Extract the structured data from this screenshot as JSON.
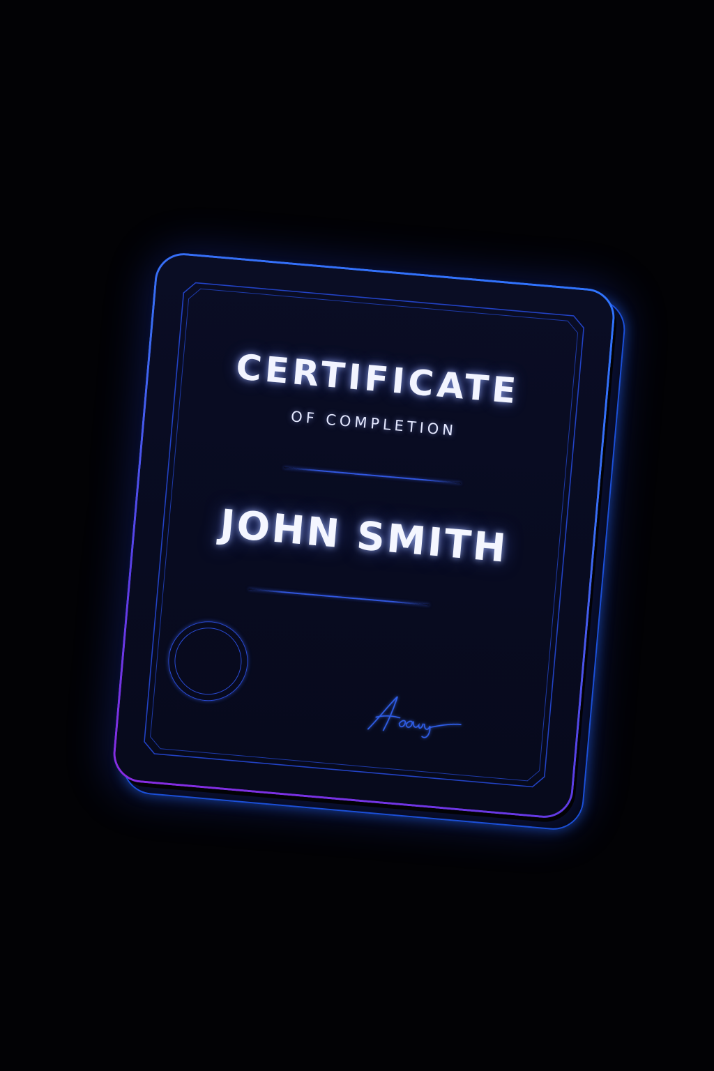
{
  "certificate": {
    "title": "CERTIFICATE",
    "subtitle": "OF COMPLETION",
    "recipient": "JOHN SMITH",
    "signature": "Aeeug"
  },
  "colors": {
    "background": "#020205",
    "card_fill": "#0a0d24",
    "border_glow_start": "#2f74ff",
    "border_glow_end": "#8a2be2",
    "accent_line": "#3157e0",
    "text": "#f2f4ff"
  },
  "icons": {
    "seal": "seal-icon",
    "signature": "signature-icon"
  }
}
